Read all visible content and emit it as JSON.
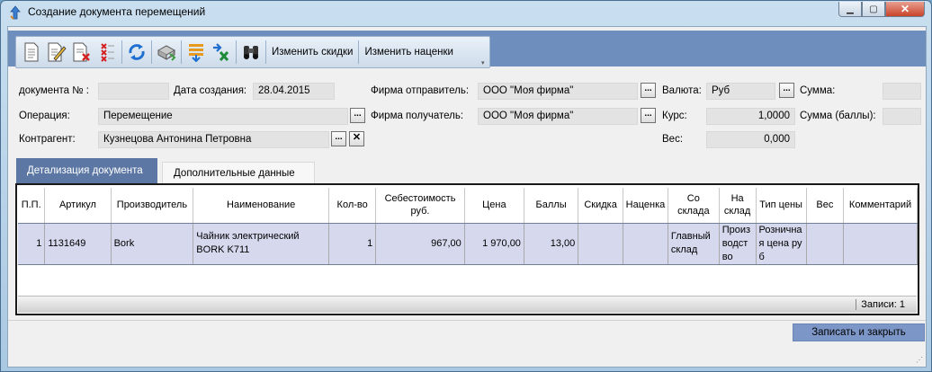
{
  "window": {
    "title": "Создание документа перемещений"
  },
  "toolbar": {
    "icons": [
      "new-document-icon",
      "edit-document-icon",
      "delete-document-icon",
      "delete-rows-icon",
      "refresh-icon",
      "print-icon",
      "sort-icon",
      "export-excel-icon",
      "search-binoculars-icon"
    ],
    "change_discounts": "Изменить скидки",
    "change_markups": "Изменить наценки"
  },
  "form": {
    "doc_number_label": "документа № :",
    "doc_number_value": "",
    "created_label": "Дата создания:",
    "created_value": "28.04.2015",
    "operation_label": "Операция:",
    "operation_value": "Перемещение",
    "counterparty_label": "Контрагент:",
    "counterparty_value": "Кузнецова Антонина Петровна",
    "sender_label": "Фирма отправитель:",
    "sender_value": "ООО \"Моя фирма\"",
    "receiver_label": "Фирма получатель:",
    "receiver_value": "ООО \"Моя фирма\"",
    "currency_label": "Валюта:",
    "currency_value": "Руб",
    "rate_label": "Курс:",
    "rate_value": "1,0000",
    "weight_label": "Вес:",
    "weight_value": "0,000",
    "sum_label": "Сумма:",
    "sum_value": "",
    "sum_points_label": "Сумма (баллы):",
    "sum_points_value": "",
    "dots": "...",
    "clear": "✕"
  },
  "tabs": {
    "details": "Детализация документа",
    "additional": "Дополнительные данные"
  },
  "grid": {
    "columns": [
      "П.П.",
      "Артикул",
      "Производитель",
      "Наименование",
      "Кол-во",
      "Себестоимость руб.",
      "Цена",
      "Баллы",
      "Скидка",
      "Наценка",
      "Со склада",
      "На склад",
      "Тип цены",
      "Вес",
      "Комментарий"
    ],
    "rows": [
      {
        "pp": "1",
        "article": "1131649",
        "maker": "Bork",
        "name": "Чайник электрический BORK K711",
        "qty": "1",
        "cost": "967,00",
        "price": "1 970,00",
        "points": "13,00",
        "discount": "",
        "markup": "",
        "from": "Главный склад",
        "to": "Производство",
        "price_type": "Розничная цена руб",
        "weight": "",
        "comment": ""
      }
    ],
    "records_label": "Записи:",
    "records_count": "1"
  },
  "buttons": {
    "save_close": "Записать и закрыть"
  },
  "colors": {
    "accent": "#5c77a3",
    "row_selected": "#d6d9ee",
    "toolbar_strip": "#6e8fbe"
  }
}
